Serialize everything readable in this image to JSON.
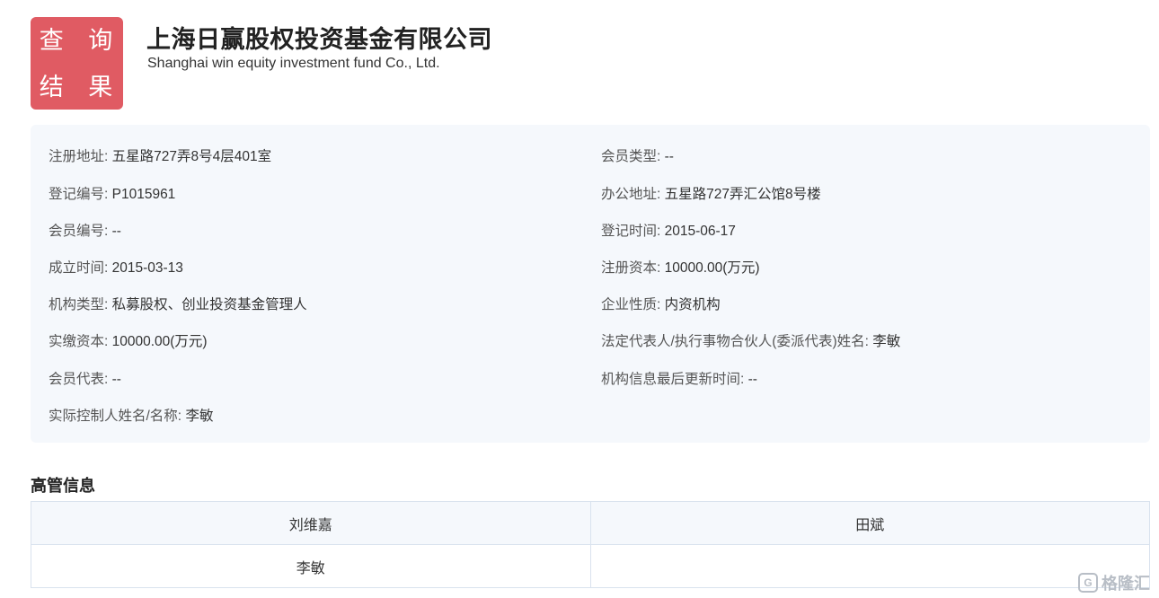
{
  "header": {
    "badge_line1": "查 询",
    "badge_line2": "结 果",
    "company_name_cn": "上海日赢股权投资基金有限公司",
    "company_name_en": "Shanghai win equity investment fund Co., Ltd."
  },
  "info": {
    "left": [
      {
        "label": "注册地址:",
        "value": "五星路727弄8号4层401室"
      },
      {
        "label": "登记编号:",
        "value": "P1015961"
      },
      {
        "label": "会员编号:",
        "value": "--"
      },
      {
        "label": "成立时间:",
        "value": "2015-03-13"
      },
      {
        "label": "机构类型:",
        "value": "私募股权、创业投资基金管理人"
      },
      {
        "label": "实缴资本:",
        "value": "10000.00(万元)"
      },
      {
        "label": "会员代表:",
        "value": "--"
      },
      {
        "label": "实际控制人姓名/名称:",
        "value": "李敏"
      }
    ],
    "right": [
      {
        "label": "会员类型:",
        "value": "--"
      },
      {
        "label": "办公地址:",
        "value": "五星路727弄汇公馆8号楼"
      },
      {
        "label": "登记时间:",
        "value": "2015-06-17"
      },
      {
        "label": "注册资本:",
        "value": "10000.00(万元)"
      },
      {
        "label": "企业性质:",
        "value": "内资机构"
      },
      {
        "label": "法定代表人/执行事物合伙人(委派代表)姓名:",
        "value": "李敏"
      },
      {
        "label": "机构信息最后更新时间:",
        "value": "--"
      }
    ]
  },
  "management": {
    "title": "高管信息",
    "rows": [
      [
        "刘维嘉",
        "田斌"
      ],
      [
        "李敏",
        ""
      ]
    ]
  },
  "watermark": {
    "icon_text": "G",
    "text": "格隆汇"
  }
}
